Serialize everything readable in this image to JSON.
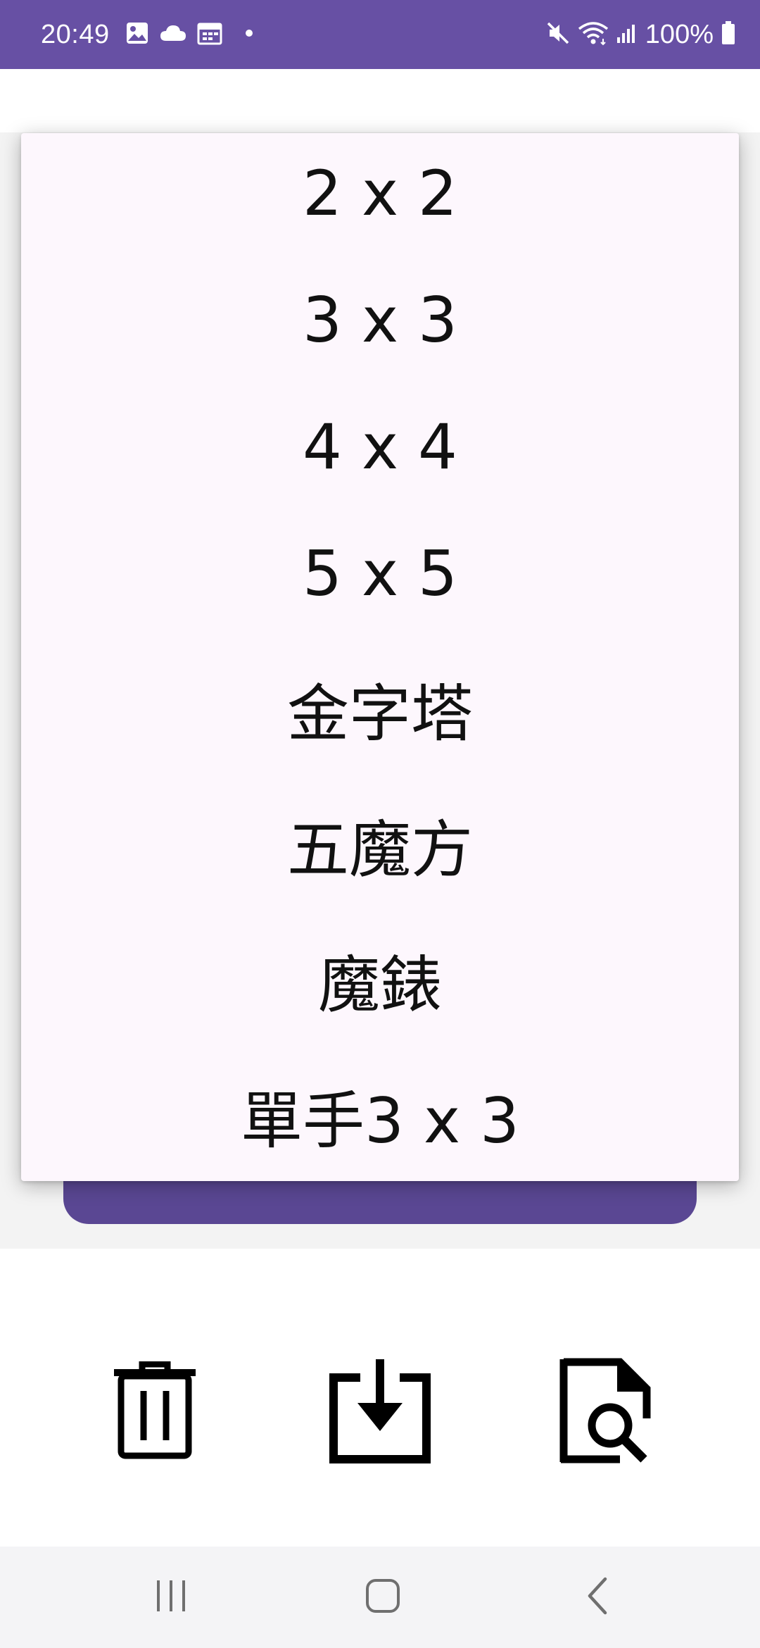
{
  "status_bar": {
    "time": "20:49",
    "battery_percent": "100%",
    "left_icons": [
      "gallery-icon",
      "cloud-icon",
      "calendar-icon",
      "dot-icon"
    ],
    "right_icons": [
      "mute-icon",
      "wifi-icon",
      "signal-icon",
      "battery-icon"
    ],
    "background_color": "#6750A4"
  },
  "dropdown_menu": {
    "items": [
      {
        "label": "2 x 2"
      },
      {
        "label": "3 x 3"
      },
      {
        "label": "4 x 4"
      },
      {
        "label": "5 x 5"
      },
      {
        "label": "金字塔"
      },
      {
        "label": "五魔方"
      },
      {
        "label": "魔錶"
      },
      {
        "label": "單手3 x 3"
      }
    ],
    "background_color": "#FDF7FD"
  },
  "toolbar": {
    "buttons": [
      {
        "icon": "trash-icon"
      },
      {
        "icon": "download-icon"
      },
      {
        "icon": "file-search-icon"
      }
    ]
  },
  "navigation_bar": {
    "buttons": [
      {
        "icon": "recent-apps-icon"
      },
      {
        "icon": "home-icon"
      },
      {
        "icon": "back-icon"
      }
    ]
  },
  "accent_color": "#5A4793"
}
